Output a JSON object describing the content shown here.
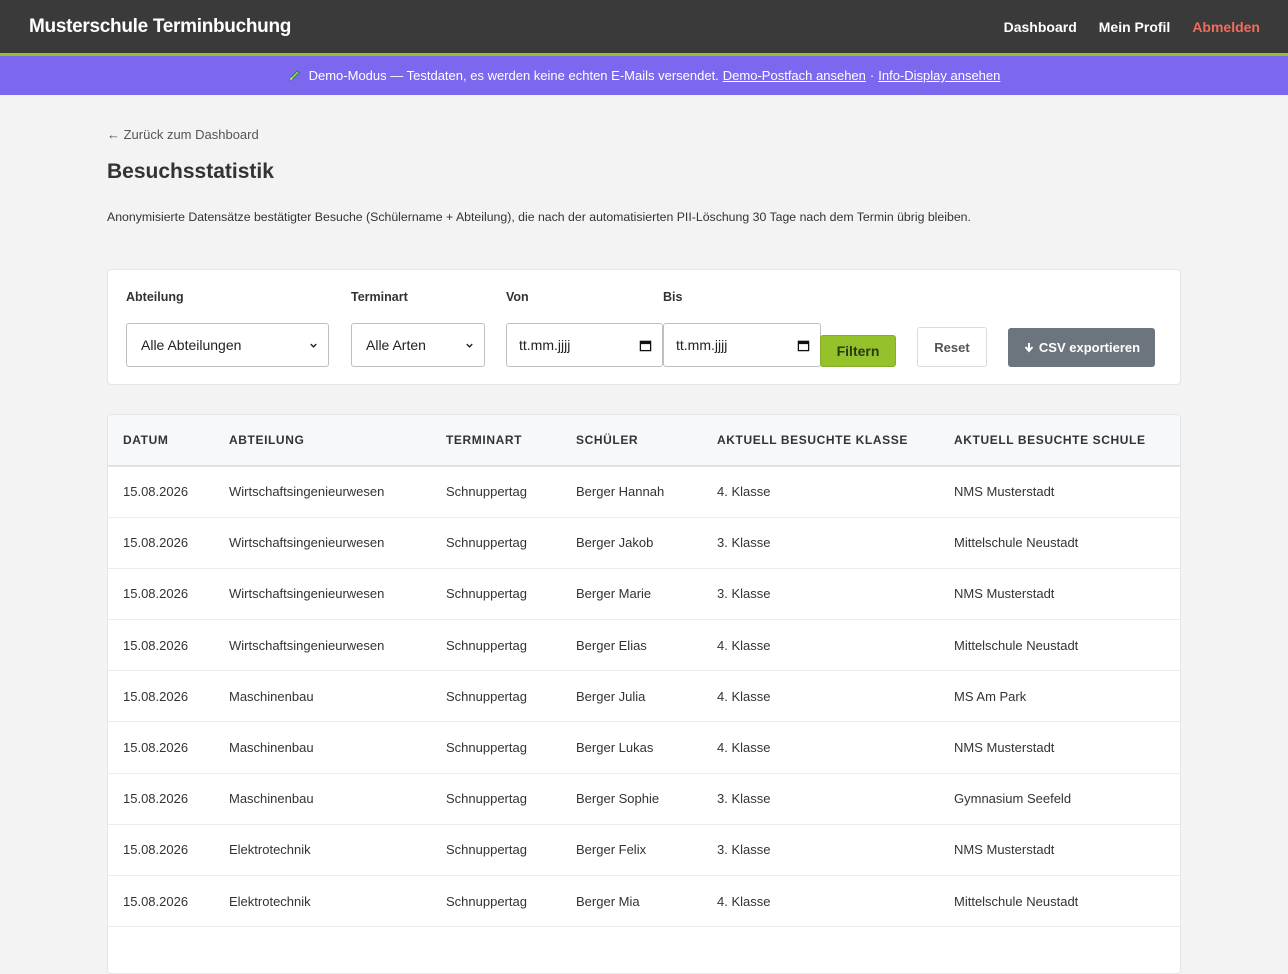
{
  "header": {
    "brand": "Musterschule Terminbuchung",
    "nav": {
      "dashboard": "Dashboard",
      "profile": "Mein Profil",
      "logout": "Abmelden"
    }
  },
  "banner": {
    "text": "Demo-Modus — Testdaten, es werden keine echten E-Mails versendet.",
    "link_mailbox": "Demo-Postfach ansehen",
    "separator": "·",
    "link_display": "Info-Display ansehen"
  },
  "page": {
    "back_link": "← Zurück zum Dashboard",
    "title": "Besuchsstatistik",
    "description": "Anonymisierte Datensätze bestätigter Besuche (Schülername + Abteilung), die nach der automatisierten PII-Löschung 30 Tage nach dem Termin übrig bleiben."
  },
  "filters": {
    "department_label": "Abteilung",
    "department_value": "Alle Abteilungen",
    "type_label": "Terminart",
    "type_value": "Alle Arten",
    "from_label": "Von",
    "from_placeholder": "tt.mm.jjjj",
    "to_label": "Bis",
    "to_placeholder": "tt.mm.jjjj",
    "filter_button": "Filtern",
    "reset_button": "Reset",
    "csv_button": "CSV exportieren"
  },
  "table": {
    "headers": [
      "Datum",
      "Abteilung",
      "Terminart",
      "Schüler",
      "Aktuell besuchte Klasse",
      "Aktuell besuchte Schule"
    ],
    "rows": [
      [
        "15.08.2026",
        "Wirtschaftsingenieurwesen",
        "Schnuppertag",
        "Berger Hannah",
        "4. Klasse",
        "NMS Musterstadt"
      ],
      [
        "15.08.2026",
        "Wirtschaftsingenieurwesen",
        "Schnuppertag",
        "Berger Jakob",
        "3. Klasse",
        "Mittelschule Neustadt"
      ],
      [
        "15.08.2026",
        "Wirtschaftsingenieurwesen",
        "Schnuppertag",
        "Berger Marie",
        "3. Klasse",
        "NMS Musterstadt"
      ],
      [
        "15.08.2026",
        "Wirtschaftsingenieurwesen",
        "Schnuppertag",
        "Berger Elias",
        "4. Klasse",
        "Mittelschule Neustadt"
      ],
      [
        "15.08.2026",
        "Maschinenbau",
        "Schnuppertag",
        "Berger Julia",
        "4. Klasse",
        "MS Am Park"
      ],
      [
        "15.08.2026",
        "Maschinenbau",
        "Schnuppertag",
        "Berger Lukas",
        "4. Klasse",
        "NMS Musterstadt"
      ],
      [
        "15.08.2026",
        "Maschinenbau",
        "Schnuppertag",
        "Berger Sophie",
        "3. Klasse",
        "Gymnasium Seefeld"
      ],
      [
        "15.08.2026",
        "Elektrotechnik",
        "Schnuppertag",
        "Berger Felix",
        "3. Klasse",
        "NMS Musterstadt"
      ],
      [
        "15.08.2026",
        "Elektrotechnik",
        "Schnuppertag",
        "Berger Mia",
        "4. Klasse",
        "Mittelschule Neustadt"
      ]
    ]
  },
  "colors": {
    "topbar": "#3a3a3a",
    "accent_green": "#95c12b",
    "banner": "#7b68ee",
    "logout": "#f06c5e",
    "csv_button": "#6c757d"
  },
  "icons": {
    "banner": "pencil-icon",
    "select": "chevron-down-icon",
    "date": "calendar-icon",
    "csv": "download-arrow-icon"
  }
}
